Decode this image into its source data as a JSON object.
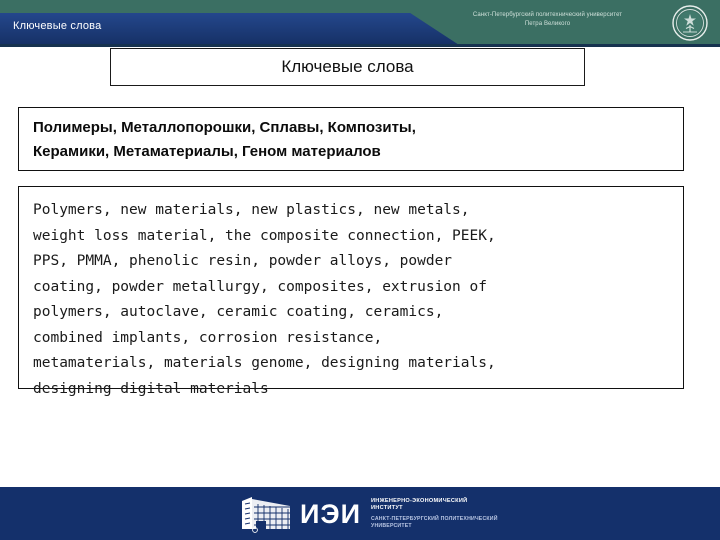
{
  "header": {
    "section_label": "Ключевые слова",
    "university_line1": "Санкт-Петербургский политехнический университет",
    "university_line2": "Петра Великого",
    "logo_icon": "university-seal-icon",
    "teal_color": "#3b6f63",
    "banner_color": "#1b3a7a"
  },
  "slide": {
    "title": "Ключевые слова",
    "keywords_ru": "Полимеры, Металлопорошки, Сплавы, Композиты,\nКерамики, Метаматериалы, Геном материалов",
    "keywords_en": "Polymers, new materials, new plastics, new metals,\nweight loss material, the composite connection, PEEK,\nPPS, PMMA, phenolic resin, powder alloys, powder\ncoating, powder metallurgy, composites, extrusion of\npolymers, autoclave, ceramic coating, ceramics,\ncombined implants, corrosion resistance,\nmetamaterials, materials genome, designing materials,\ndesigning digital materials"
  },
  "footer": {
    "brand": "ИЭИ",
    "institute_name": "ИНЖЕНЕРНО-ЭКОНОМИЧЕСКИЙ\nИНСТИТУТ",
    "university_name": "САНКТ-ПЕТЕРБУРГСКИЙ ПОЛИТЕХНИЧЕСКИЙ\nУНИВЕРСИТЕТ",
    "building_icon": "building-icon",
    "background_color": "#14306b"
  }
}
